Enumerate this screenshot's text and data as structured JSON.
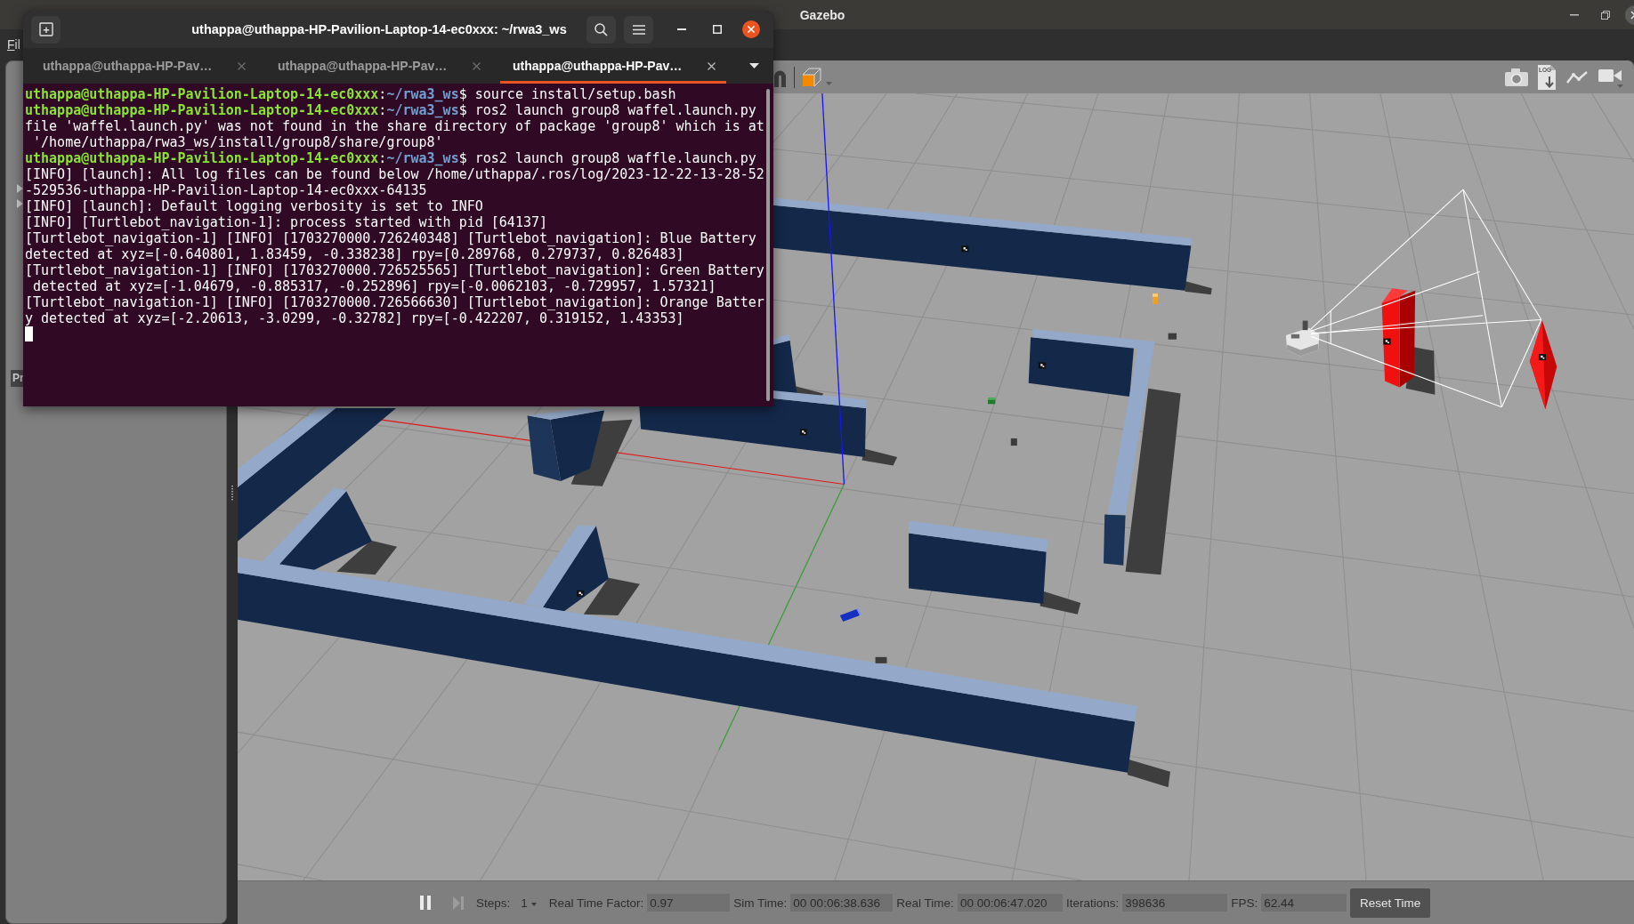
{
  "window": {
    "title": "Gazebo"
  },
  "menu": [
    {
      "label": "Fil"
    }
  ],
  "terminal": {
    "title": "uthappa@uthappa-HP-Pavilion-Laptop-14-ec0xxx: ~/rwa3_ws",
    "tabs": [
      {
        "label": "uthappa@uthappa-HP-Pav…",
        "selected": false
      },
      {
        "label": "uthappa@uthappa-HP-Pav…",
        "selected": false
      },
      {
        "label": "uthappa@uthappa-HP-Pav…",
        "selected": true
      }
    ],
    "lines": [
      {
        "kind": "prompt",
        "user": "uthappa@uthappa-HP-Pavilion-Laptop-14-ec0xxx",
        "separator": ":",
        "path": "~/rwa3_ws",
        "command": "$ source install/setup.bash"
      },
      {
        "kind": "prompt",
        "user": "uthappa@uthappa-HP-Pavilion-Laptop-14-ec0xxx",
        "separator": ":",
        "path": "~/rwa3_ws",
        "command": "$ ros2 launch group8 waffel.launch.py"
      },
      {
        "kind": "output",
        "text": "file 'waffel.launch.py' was not found in the share directory of package 'group8' which is at"
      },
      {
        "kind": "output",
        "text": " '/home/uthappa/rwa3_ws/install/group8/share/group8'"
      },
      {
        "kind": "prompt",
        "user": "uthappa@uthappa-HP-Pavilion-Laptop-14-ec0xxx",
        "separator": ":",
        "path": "~/rwa3_ws",
        "command": "$ ros2 launch group8 waffle.launch.py"
      },
      {
        "kind": "output",
        "text": "[INFO] [launch]: All log files can be found below /home/uthappa/.ros/log/2023-12-22-13-28-52"
      },
      {
        "kind": "output",
        "text": "-529536-uthappa-HP-Pavilion-Laptop-14-ec0xxx-64135"
      },
      {
        "kind": "output",
        "text": "[INFO] [launch]: Default logging verbosity is set to INFO"
      },
      {
        "kind": "output",
        "text": "[INFO] [Turtlebot_navigation-1]: process started with pid [64137]"
      },
      {
        "kind": "output",
        "text": "[Turtlebot_navigation-1] [INFO] [1703270000.726240348] [Turtlebot_navigation]: Blue Battery"
      },
      {
        "kind": "output",
        "text": "detected at xyz=[-0.640801, 1.83459, -0.338238] rpy=[0.289768, 0.279737, 0.826483]"
      },
      {
        "kind": "output",
        "text": "[Turtlebot_navigation-1] [INFO] [1703270000.726525565] [Turtlebot_navigation]: Green Battery"
      },
      {
        "kind": "output",
        "text": " detected at xyz=[-1.04679, -0.885317, -0.252896] rpy=[-0.0062103, -0.729957, 1.57321]"
      },
      {
        "kind": "output",
        "text": "[Turtlebot_navigation-1] [INFO] [1703270000.726566630] [Turtlebot_navigation]: Orange Batter"
      },
      {
        "kind": "output",
        "text": "y detected at xyz=[-2.20613, -3.0299, -0.32782] rpy=[-0.422207, 0.319152, 1.43353]"
      },
      {
        "kind": "cursor"
      }
    ]
  },
  "side_panel": {
    "tab": "Pr"
  },
  "toolbar": {
    "log_label": "LOG"
  },
  "status_bar": {
    "playing": true,
    "step_disabled": true,
    "steps_label": "Steps:",
    "steps_value": "1",
    "readouts": [
      {
        "label": "Real Time Factor:",
        "value": "0.97"
      },
      {
        "label": "Sim Time:",
        "value": "00 00:06:38.636"
      },
      {
        "label": "Real Time:",
        "value": "00 00:06:47.020"
      },
      {
        "label": "Iterations:",
        "value": "398636"
      },
      {
        "label": "FPS:",
        "value": "62.44"
      }
    ],
    "reset_button": "Reset Time"
  }
}
